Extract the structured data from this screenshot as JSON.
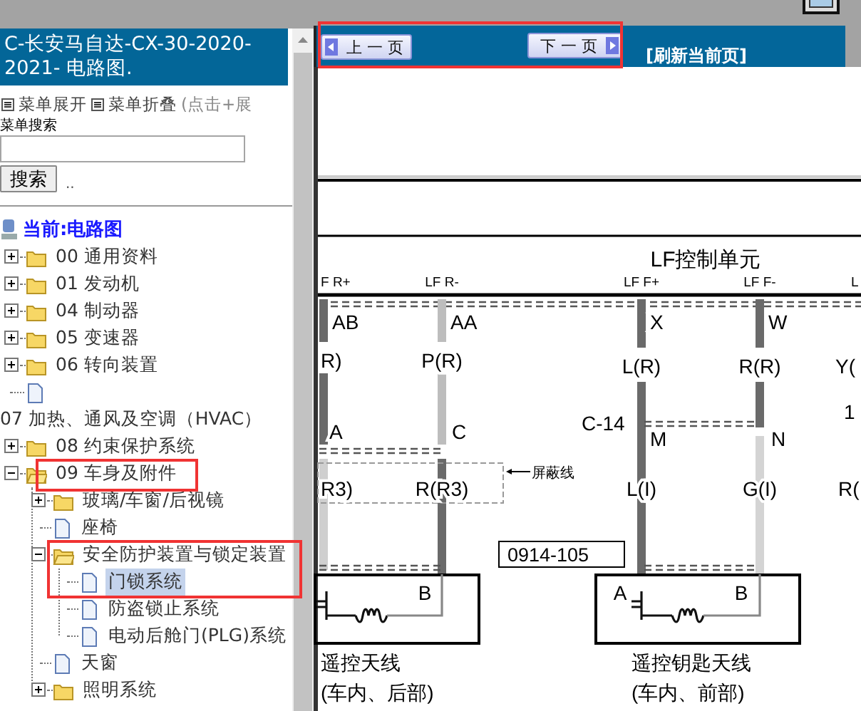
{
  "left_panel": {
    "title": "C-长安马自达-CX-30-2020-2021- 电路图.",
    "menu_expand": "菜单展开",
    "menu_collapse": "菜单折叠",
    "menu_hint": "(点击+展",
    "search_label": "菜单搜索",
    "search_button": "搜索",
    "search_extra": "..",
    "current": "当前:电路图"
  },
  "tree": [
    {
      "kind": "folder",
      "label": "00 通用资料",
      "expanded": false,
      "selected": false
    },
    {
      "kind": "folder",
      "label": "01 发动机",
      "expanded": false,
      "selected": false
    },
    {
      "kind": "folder",
      "label": "04 制动器",
      "expanded": false,
      "selected": false
    },
    {
      "kind": "folder",
      "label": "05 变速器",
      "expanded": false,
      "selected": false
    },
    {
      "kind": "folder",
      "label": "06 转向装置",
      "expanded": false,
      "selected": false
    },
    {
      "kind": "page"
    },
    {
      "kind": "text",
      "label": "07 加热、通风及空调（HVAC）"
    },
    {
      "kind": "folder",
      "label": "08 约束保护系统",
      "expanded": false,
      "selected": false
    },
    {
      "kind": "folder",
      "label": "09 车身及附件",
      "expanded": true,
      "selected": false,
      "children": [
        {
          "kind": "folder",
          "label": "玻璃/车窗/后视镜",
          "expanded": false,
          "selected": false
        },
        {
          "kind": "page",
          "label": "座椅",
          "selected": false
        },
        {
          "kind": "folder",
          "label": "安全防护装置与锁定装置",
          "expanded": true,
          "selected": false,
          "children": [
            {
              "kind": "page",
              "label": "门锁系统",
              "selected": true
            },
            {
              "kind": "page",
              "label": "防盗锁止系统",
              "selected": false
            },
            {
              "kind": "page",
              "label": "电动后舱门(PLG)系统",
              "selected": false
            }
          ]
        },
        {
          "kind": "page",
          "label": "天窗",
          "selected": false
        },
        {
          "kind": "folder",
          "label": "照明系统",
          "expanded": false,
          "selected": false
        }
      ]
    }
  ],
  "toolbar": {
    "prev": "上 一 页",
    "next": "下 一 页",
    "refresh": "[刷新当前页]"
  },
  "diagram": {
    "title": "LF控制单元",
    "pins": [
      "F R+",
      "LF R-",
      "LF F+",
      "LF F-",
      "L"
    ],
    "labels": [
      "AB",
      "AA",
      "X",
      "W",
      "R)",
      "P(R)",
      "L(R)",
      "R(R)",
      "Y(",
      "1",
      "C-14",
      "M",
      "N",
      "A",
      "C",
      "R3)",
      "R(R3)",
      "L(I)",
      "G(I)",
      "R(",
      "B",
      "A",
      "B"
    ],
    "shield_label": "屏蔽线",
    "part_number": "0914-105",
    "components": [
      {
        "name": "遥控天线",
        "location": "(车内、后部)"
      },
      {
        "name": "遥控钥匙天线",
        "location": "(车内、前部)"
      }
    ]
  }
}
